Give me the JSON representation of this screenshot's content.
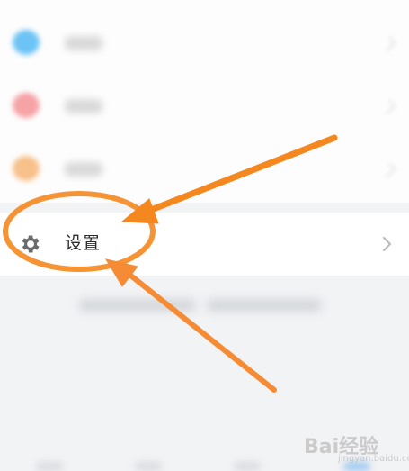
{
  "menu": {
    "blurred_items": [
      {
        "icon": "blue-circle-icon",
        "color": "#6cc3f5"
      },
      {
        "icon": "red-circle-icon",
        "color": "#f6a3a6"
      },
      {
        "icon": "orange-circle-icon",
        "color": "#f8c08a"
      }
    ],
    "settings": {
      "label": "设置",
      "icon": "gear-icon",
      "chevron": "chevron-right-icon"
    }
  },
  "annotation": {
    "color": "#f5871f",
    "shapes": [
      "ellipse-highlight",
      "arrow-top-right",
      "arrow-bottom-right"
    ]
  },
  "watermark": {
    "text": "Bai经验",
    "sub": "jingyan.baidu.com"
  }
}
